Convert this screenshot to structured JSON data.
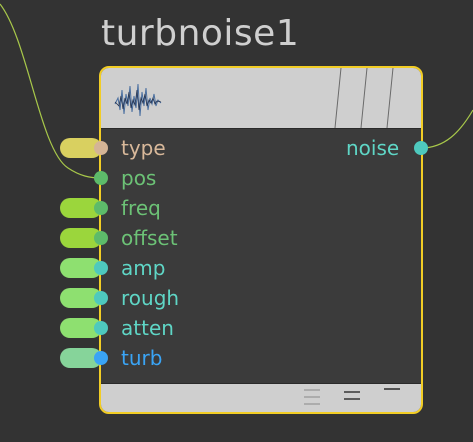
{
  "node": {
    "title": "turbnoise1",
    "border_color": "#f2cd25",
    "header_icon": "waveform-icon"
  },
  "inputs": [
    {
      "label": "type",
      "pill_color": "#d9d060",
      "dot_color": "#d4b496",
      "label_color": "#d8b89a",
      "connected": false
    },
    {
      "label": "pos",
      "pill_color": null,
      "dot_color": "#5dbb6a",
      "label_color": "#6cc276",
      "connected": true
    },
    {
      "label": "freq",
      "pill_color": "#9bd63c",
      "dot_color": "#5dbb6a",
      "label_color": "#6cc276",
      "connected": false
    },
    {
      "label": "offset",
      "pill_color": "#9bd63c",
      "dot_color": "#5dbb6a",
      "label_color": "#6cc276",
      "connected": false
    },
    {
      "label": "amp",
      "pill_color": "#8ee070",
      "dot_color": "#4ec9be",
      "label_color": "#5fd6c6",
      "connected": false
    },
    {
      "label": "rough",
      "pill_color": "#8ee070",
      "dot_color": "#4ec9be",
      "label_color": "#5fd6c6",
      "connected": false
    },
    {
      "label": "atten",
      "pill_color": "#8ee070",
      "dot_color": "#4ec9be",
      "label_color": "#5fd6c6",
      "connected": false
    },
    {
      "label": "turb",
      "pill_color": "#86d49a",
      "dot_color": "#3aa4f5",
      "label_color": "#3aa4f5",
      "connected": false
    }
  ],
  "outputs": [
    {
      "label": "noise",
      "dot_color": "#4ec9be",
      "label_color": "#5fd6c6",
      "connected": true
    }
  ],
  "wire_color": "#a8c84a"
}
